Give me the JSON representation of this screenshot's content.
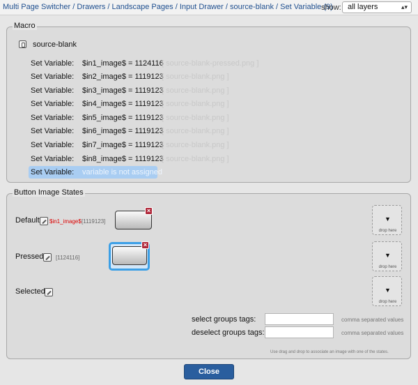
{
  "header": {
    "breadcrumb": [
      "Multi Page Switcher",
      "Drawers",
      "Landscape Pages",
      "Input Drawer",
      "source-blank",
      "Set Variable (9)"
    ],
    "separator": "/",
    "show_label": "show:",
    "show_value": "all layers"
  },
  "macro": {
    "legend": "Macro",
    "source_label": "source-blank",
    "set_variables": [
      {
        "key": "Set Variable:",
        "value": "$in1_image$ = 1124116",
        "file": "[ source-blank-pressed.png ]"
      },
      {
        "key": "Set Variable:",
        "value": "$in2_image$ = 1119123",
        "file": "[ source-blank.png ]"
      },
      {
        "key": "Set Variable:",
        "value": "$in3_image$ = 1119123",
        "file": "[ source-blank.png ]"
      },
      {
        "key": "Set Variable:",
        "value": "$in4_image$ = 1119123",
        "file": "[ source-blank.png ]"
      },
      {
        "key": "Set Variable:",
        "value": "$in5_image$ = 1119123",
        "file": "[ source-blank.png ]"
      },
      {
        "key": "Set Variable:",
        "value": "$in6_image$ = 1119123",
        "file": "[ source-blank.png ]"
      },
      {
        "key": "Set Variable:",
        "value": "$in7_image$ = 1119123",
        "file": "[ source-blank.png ]"
      },
      {
        "key": "Set Variable:",
        "value": "$in8_image$ = 1119123",
        "file": "[ source-blank.png ]"
      },
      {
        "key": "Set Variable:",
        "value": "variable is not assigned",
        "file": ""
      }
    ]
  },
  "states": {
    "legend": "Button Image States",
    "default_label": "Default",
    "default_var": "$in1_image$",
    "default_id": "[1119123]",
    "pressed_label": "Pressed",
    "pressed_id": "[1124116]",
    "selected_label": "Selected",
    "drop_here": "drop here",
    "delete_glyph": "×",
    "drop_glyph": "▼",
    "select_tags_label": "select groups tags:",
    "deselect_tags_label": "deselect groups tags:",
    "select_tags_value": "",
    "deselect_tags_value": "",
    "tags_hint": "comma separated values",
    "dnd_note": "Use drag and drop to associate an image with one of the states."
  },
  "footer": {
    "close_label": "Close"
  },
  "colors": {
    "link": "#1f4f8f",
    "selected_row": "#a9cdf2",
    "pressed_frame": "#3b9fe6",
    "delete_badge": "#b0283a",
    "close_button": "#2a5e9e",
    "variable_red": "#dd0000"
  }
}
